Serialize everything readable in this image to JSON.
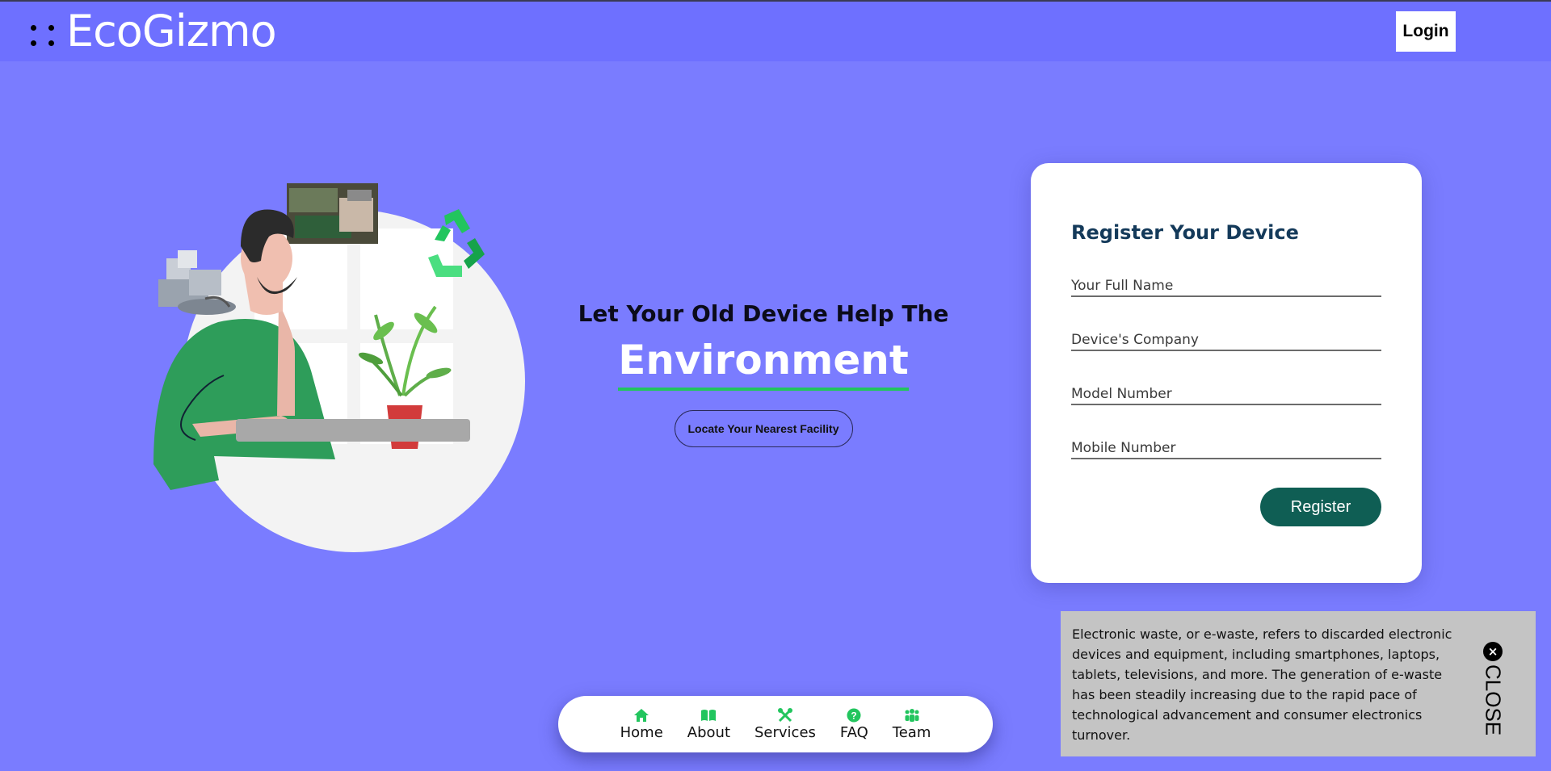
{
  "header": {
    "brand": "EcoGizmo",
    "login_label": "Login"
  },
  "hero": {
    "line1": "Let Your Old Device Help The",
    "line2": "Environment",
    "cta_label": "Locate Your Nearest Facility"
  },
  "register": {
    "title": "Register Your Device",
    "fields": [
      {
        "placeholder": "Your Full Name"
      },
      {
        "placeholder": "Device's Company"
      },
      {
        "placeholder": "Model Number"
      },
      {
        "placeholder": "Mobile Number"
      }
    ],
    "submit_label": "Register"
  },
  "info_panel": {
    "text": "Electronic waste, or e-waste, refers to discarded electronic devices and equipment, including smartphones, laptops, tablets, televisions, and more. The generation of e-waste has been steadily increasing due to the rapid pace of technological advancement and consumer electronics turnover.",
    "close_label": "CLOSE",
    "close_icon": "close-icon"
  },
  "bottom_nav": {
    "items": [
      {
        "label": "Home",
        "icon": "home-icon"
      },
      {
        "label": "About",
        "icon": "book-icon"
      },
      {
        "label": "Services",
        "icon": "tools-icon"
      },
      {
        "label": "FAQ",
        "icon": "question-icon"
      },
      {
        "label": "Team",
        "icon": "team-icon"
      }
    ]
  },
  "colors": {
    "background": "#7a7cff",
    "header": "#6e70ff",
    "accent_green": "#22c55e",
    "register_button": "#0f5e54",
    "title_color": "#143a5a"
  }
}
